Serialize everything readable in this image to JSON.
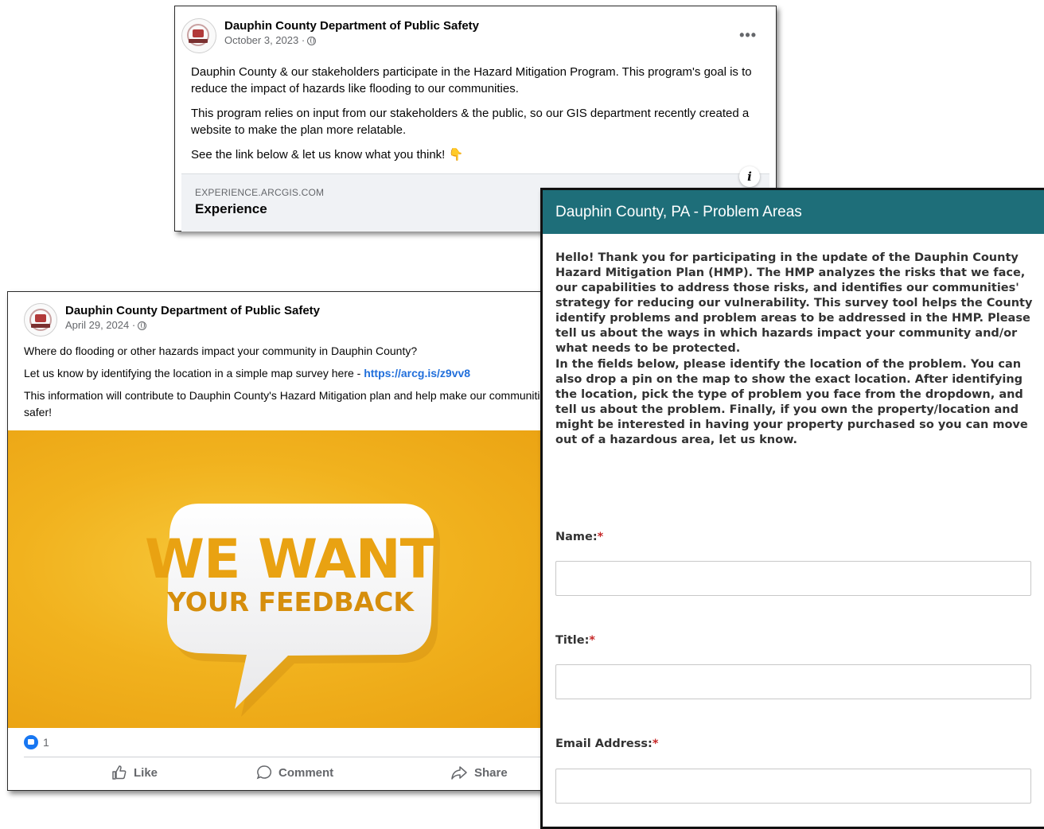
{
  "post1": {
    "page_name": "Dauphin County Department of Public Safety",
    "date": "October 3, 2023 ·",
    "paragraphs": [
      "Dauphin County & our stakeholders participate in the Hazard Mitigation Program. This program's goal is to reduce the impact of hazards like flooding to our communities.",
      "This program relies on input from our stakeholders & the public, so our GIS department recently created a website to make the plan more relatable.",
      "See the link below & let us know what you think! 👇"
    ],
    "more_label": "•••",
    "link_domain": "EXPERIENCE.ARCGIS.COM",
    "link_title": "Experience",
    "info_label": "i"
  },
  "post2": {
    "page_name": "Dauphin County Department of Public Safety",
    "date": "April 29, 2024 ·",
    "line1": "Where do flooding or other hazards impact your community in Dauphin County?",
    "line2_prefix": "Let us know by identifying the location in a simple map survey here - ",
    "line2_link": "https://arcg.is/z9vv8",
    "line3": "This information will contribute to Dauphin County's Hazard Mitigation plan and help make our communities safer!",
    "image_text_line1": "WE WANT",
    "image_text_line2": "YOUR FEEDBACK",
    "reaction_count": "1",
    "actions": {
      "like": "Like",
      "comment": "Comment",
      "share": "Share"
    }
  },
  "survey": {
    "header_title": "Dauphin County, PA - Problem Areas",
    "intro_p1": "Hello! Thank you for participating in the update of the Dauphin County Hazard Mitigation Plan (HMP). The HMP analyzes the risks that we face, our capabilities to address those risks, and identifies our communities' strategy for reducing our vulnerability. This survey tool helps the County identify problems and problem areas to be addressed in the HMP. Please tell us about the ways in which hazards impact your community and/or what needs to be protected.",
    "intro_p2": "In the fields below, please identify the location of the problem. You can also drop a pin on the map to show the exact location. After identifying the location, pick the type of problem you face from the dropdown, and tell us about the problem. Finally, if you own the property/location and might be interested in having your property purchased so you can move out of a hazardous area, let us know.",
    "fields": [
      {
        "label": "Name:",
        "required_mark": "*",
        "value": ""
      },
      {
        "label": "Title:",
        "required_mark": "*",
        "value": ""
      },
      {
        "label": "Email Address:",
        "required_mark": "*",
        "value": ""
      }
    ],
    "accent_color": "#1e6e79",
    "required_color": "#c62828"
  }
}
